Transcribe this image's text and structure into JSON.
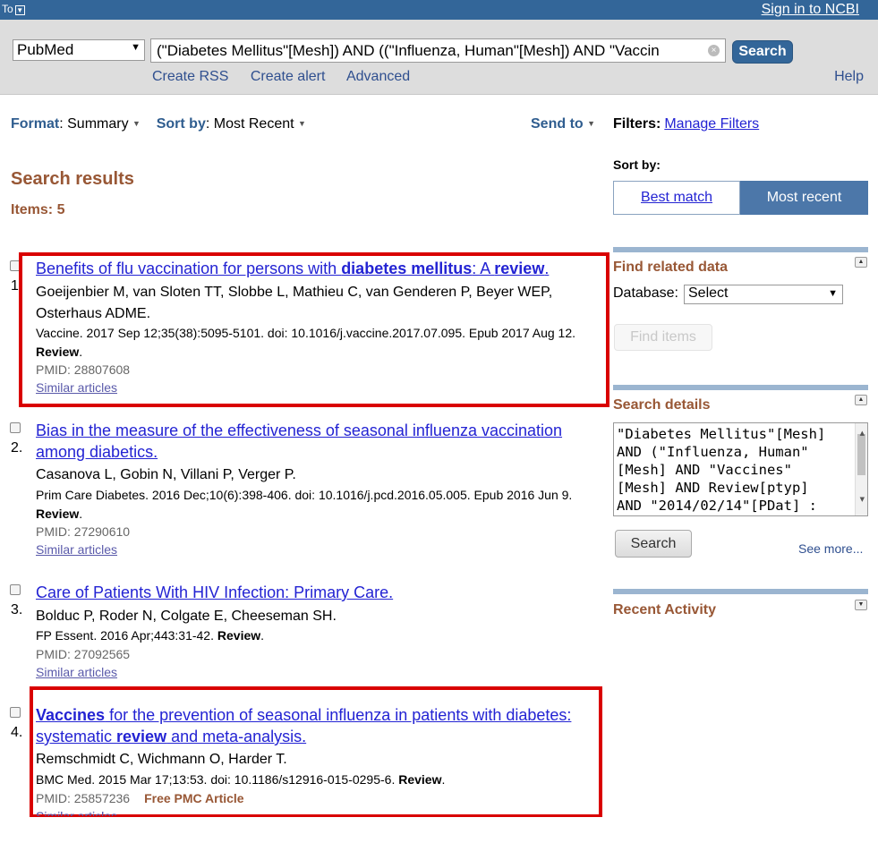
{
  "topbar": {
    "to_label": "To",
    "to_icon": "dropdown-icon",
    "signin": "Sign in to NCBI"
  },
  "search": {
    "database": "PubMed",
    "query": "(\"Diabetes Mellitus\"[Mesh]) AND ((\"Influenza, Human\"[Mesh]) AND \"Vaccin",
    "button": "Search",
    "links": [
      "Create RSS",
      "Create alert",
      "Advanced"
    ],
    "help": "Help"
  },
  "display": {
    "format_label": "Format",
    "format_value": "Summary",
    "sort_label": "Sort by",
    "sort_value": "Most Recent",
    "send_to": "Send to"
  },
  "results": {
    "heading": "Search results",
    "items_label": "Items: 5",
    "list": [
      {
        "number": "1.",
        "title_parts": [
          "Benefits of flu vaccination for persons with ",
          "diabetes mellitus",
          ": A ",
          "review",
          "."
        ],
        "authors": "Goeijenbier M, van Sloten TT, Slobbe L, Mathieu C, van Genderen P, Beyer WEP, Osterhaus ADME.",
        "journal": "Vaccine. 2017 Sep 12;35(38):5095-5101. doi: 10.1016/j.vaccine.2017.07.095. Epub 2017 Aug 12.",
        "review": "Review",
        "pmid": "PMID: 28807608",
        "free_pmc": "",
        "similar": "Similar articles"
      },
      {
        "number": "2.",
        "title": "Bias in the measure of the effectiveness of seasonal influenza vaccination among diabetics.",
        "authors": "Casanova L, Gobin N, Villani P, Verger P.",
        "journal": "Prim Care Diabetes. 2016 Dec;10(6):398-406. doi: 10.1016/j.pcd.2016.05.005. Epub 2016 Jun 9.",
        "review": "Review",
        "pmid": "PMID: 27290610",
        "free_pmc": "",
        "similar": "Similar articles"
      },
      {
        "number": "3.",
        "title": "Care of Patients With HIV Infection: Primary Care.",
        "authors": "Bolduc P, Roder N, Colgate E, Cheeseman SH.",
        "journal": "FP Essent. 2016 Apr;443:31-42.",
        "review": "Review",
        "pmid": "PMID: 27092565",
        "free_pmc": "",
        "similar": "Similar articles"
      },
      {
        "number": "4.",
        "title_parts": [
          "Vaccines",
          " for the prevention of seasonal influenza in patients with diabetes: systematic ",
          "review",
          " and meta-analysis."
        ],
        "authors": "Remschmidt C, Wichmann O, Harder T.",
        "journal": "BMC Med. 2015 Mar 17;13:53. doi: 10.1186/s12916-015-0295-6.",
        "review": "Review",
        "pmid": "PMID: 25857236",
        "free_pmc": "Free PMC Article",
        "similar": "Similar articles"
      }
    ]
  },
  "sidebar": {
    "filters_label": "Filters:",
    "manage_filters": "Manage Filters",
    "sort_by": "Sort by:",
    "sort_options": [
      "Best match",
      "Most recent"
    ],
    "find_related": {
      "title": "Find related data",
      "database_label": "Database:",
      "database_value": "Select",
      "button": "Find items"
    },
    "search_details": {
      "title": "Search details",
      "text": "\"Diabetes Mellitus\"[Mesh]\nAND (\"Influenza, Human\"\n[Mesh] AND \"Vaccines\"\n[Mesh] AND Review[ptyp]\nAND \"2014/02/14\"[PDat] :",
      "button": "Search",
      "see_more": "See more..."
    },
    "recent_activity": {
      "title": "Recent Activity"
    }
  },
  "colors": {
    "header_blue": "#336699",
    "section_brown": "#985735",
    "link_blue": "#2323d3",
    "highlight_red": "#d90000"
  }
}
